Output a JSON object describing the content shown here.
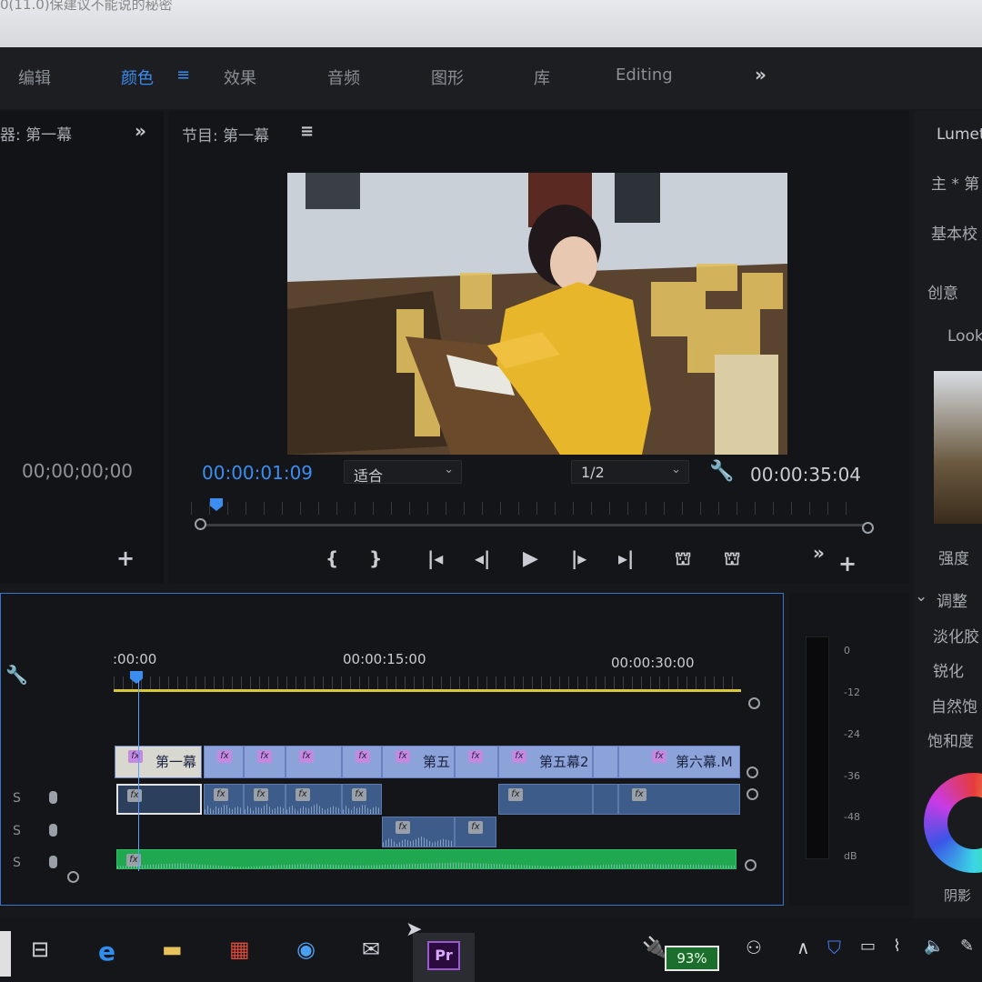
{
  "top_bar": {
    "text": "0(11.0)保建议不能说的秘密"
  },
  "workspaces": {
    "items": [
      "编辑",
      "颜色",
      "效果",
      "音频",
      "图形",
      "库",
      "Editing"
    ],
    "active": "颜色"
  },
  "source_panel": {
    "title": "器: 第一幕",
    "timecode": "00;00;00;00"
  },
  "program_panel": {
    "title": "节目: 第一幕",
    "current_time": "00:00:01:09",
    "fit_label": "适合",
    "resolution": "1/2",
    "duration": "00:00:35:04"
  },
  "timeline": {
    "ruler": [
      ":00:00",
      "00:00:15:00",
      "00:00:30:00"
    ],
    "video_clips": [
      "第一幕",
      "第五",
      "第五幕2",
      "第六幕.M"
    ],
    "tracks": [
      "S",
      "S",
      "S"
    ]
  },
  "meters": {
    "scale": [
      "0",
      "-12",
      "-24",
      "-36",
      "-48",
      "dB"
    ]
  },
  "lumetri": {
    "title": "Lumetr",
    "master": "主 * 第",
    "basic": "基本校",
    "creative": "创意",
    "look": "Look",
    "intensity": "强度",
    "adjust": "调整",
    "faded_film": "淡化胶",
    "sharpen": "锐化",
    "vibrance": "自然饱",
    "saturation": "饱和度",
    "shadow": "阴影"
  },
  "taskbar": {
    "battery": "93%",
    "premiere": "Pr"
  },
  "colors": {
    "accent": "#3c8df0",
    "workarea": "#d9c733",
    "audio_green": "#20a850"
  }
}
